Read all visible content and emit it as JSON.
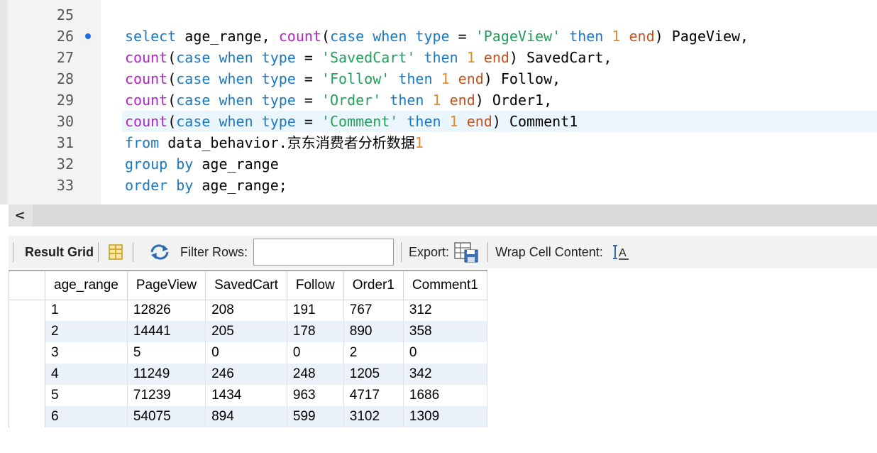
{
  "editor": {
    "lines": [
      {
        "num": "25",
        "segments": [
          {
            "c": "plain",
            "t": ""
          }
        ]
      },
      {
        "num": "26",
        "breakpoint": true,
        "segments": [
          {
            "c": "kw",
            "t": "select"
          },
          {
            "c": "plain",
            "t": " age_range, "
          },
          {
            "c": "fn",
            "t": "count"
          },
          {
            "c": "plain",
            "t": "("
          },
          {
            "c": "kw",
            "t": "case when type"
          },
          {
            "c": "plain",
            "t": " = "
          },
          {
            "c": "str",
            "t": "'PageView'"
          },
          {
            "c": "plain",
            "t": " "
          },
          {
            "c": "kw",
            "t": "then"
          },
          {
            "c": "plain",
            "t": " "
          },
          {
            "c": "num",
            "t": "1"
          },
          {
            "c": "plain",
            "t": " "
          },
          {
            "c": "end",
            "t": "end"
          },
          {
            "c": "plain",
            "t": ") PageView,"
          }
        ]
      },
      {
        "num": "27",
        "segments": [
          {
            "c": "fn",
            "t": "count"
          },
          {
            "c": "plain",
            "t": "("
          },
          {
            "c": "kw",
            "t": "case when type"
          },
          {
            "c": "plain",
            "t": " = "
          },
          {
            "c": "str",
            "t": "'SavedCart'"
          },
          {
            "c": "plain",
            "t": " "
          },
          {
            "c": "kw",
            "t": "then"
          },
          {
            "c": "plain",
            "t": " "
          },
          {
            "c": "num",
            "t": "1"
          },
          {
            "c": "plain",
            "t": " "
          },
          {
            "c": "end",
            "t": "end"
          },
          {
            "c": "plain",
            "t": ") SavedCart,"
          }
        ]
      },
      {
        "num": "28",
        "segments": [
          {
            "c": "fn",
            "t": "count"
          },
          {
            "c": "plain",
            "t": "("
          },
          {
            "c": "kw",
            "t": "case when type"
          },
          {
            "c": "plain",
            "t": " = "
          },
          {
            "c": "str",
            "t": "'Follow'"
          },
          {
            "c": "plain",
            "t": " "
          },
          {
            "c": "kw",
            "t": "then"
          },
          {
            "c": "plain",
            "t": " "
          },
          {
            "c": "num",
            "t": "1"
          },
          {
            "c": "plain",
            "t": " "
          },
          {
            "c": "end",
            "t": "end"
          },
          {
            "c": "plain",
            "t": ") Follow,"
          }
        ]
      },
      {
        "num": "29",
        "segments": [
          {
            "c": "fn",
            "t": "count"
          },
          {
            "c": "plain",
            "t": "("
          },
          {
            "c": "kw",
            "t": "case when type"
          },
          {
            "c": "plain",
            "t": " = "
          },
          {
            "c": "str",
            "t": "'Order'"
          },
          {
            "c": "plain",
            "t": " "
          },
          {
            "c": "kw",
            "t": "then"
          },
          {
            "c": "plain",
            "t": " "
          },
          {
            "c": "num",
            "t": "1"
          },
          {
            "c": "plain",
            "t": " "
          },
          {
            "c": "end",
            "t": "end"
          },
          {
            "c": "plain",
            "t": ") Order1,"
          }
        ]
      },
      {
        "num": "30",
        "current": true,
        "segments": [
          {
            "c": "fn",
            "t": "count"
          },
          {
            "c": "plain",
            "t": "("
          },
          {
            "c": "kw",
            "t": "case when type"
          },
          {
            "c": "plain",
            "t": " = "
          },
          {
            "c": "str",
            "t": "'Comment'"
          },
          {
            "c": "plain",
            "t": " "
          },
          {
            "c": "kw",
            "t": "then"
          },
          {
            "c": "plain",
            "t": " "
          },
          {
            "c": "num",
            "t": "1"
          },
          {
            "c": "plain",
            "t": " "
          },
          {
            "c": "end",
            "t": "end"
          },
          {
            "c": "plain",
            "t": ") Comment1"
          }
        ]
      },
      {
        "num": "31",
        "segments": [
          {
            "c": "kw",
            "t": "from"
          },
          {
            "c": "plain",
            "t": " data_behavior."
          },
          {
            "c": "cjk",
            "t": "京东消费者分析数据"
          },
          {
            "c": "num",
            "t": "1"
          }
        ]
      },
      {
        "num": "32",
        "segments": [
          {
            "c": "kw",
            "t": "group by"
          },
          {
            "c": "plain",
            "t": " age_range"
          }
        ]
      },
      {
        "num": "33",
        "segments": [
          {
            "c": "kw",
            "t": "order by"
          },
          {
            "c": "plain",
            "t": " age_range;"
          }
        ]
      }
    ]
  },
  "scrollbar": {
    "left_arrow": "<"
  },
  "toolbar": {
    "result_grid": "Result Grid",
    "filter_rows": "Filter Rows:",
    "filter_value": "",
    "export": "Export:",
    "wrap": "Wrap Cell Content:"
  },
  "grid": {
    "columns": [
      "age_range",
      "PageView",
      "SavedCart",
      "Follow",
      "Order1",
      "Comment1"
    ],
    "rows": [
      [
        "1",
        "12826",
        "208",
        "191",
        "767",
        "312"
      ],
      [
        "2",
        "14441",
        "205",
        "178",
        "890",
        "358"
      ],
      [
        "3",
        "5",
        "0",
        "0",
        "2",
        "0"
      ],
      [
        "4",
        "11249",
        "246",
        "248",
        "1205",
        "342"
      ],
      [
        "5",
        "71239",
        "1434",
        "963",
        "4717",
        "1686"
      ],
      [
        "6",
        "54075",
        "894",
        "599",
        "3102",
        "1309"
      ]
    ]
  },
  "colors": {
    "keyword": "#1a79c4",
    "function": "#b423c7",
    "string": "#21a05a",
    "number": "#e08a2c",
    "end": "#c0521f",
    "alt_row": "#eaf1f9"
  }
}
